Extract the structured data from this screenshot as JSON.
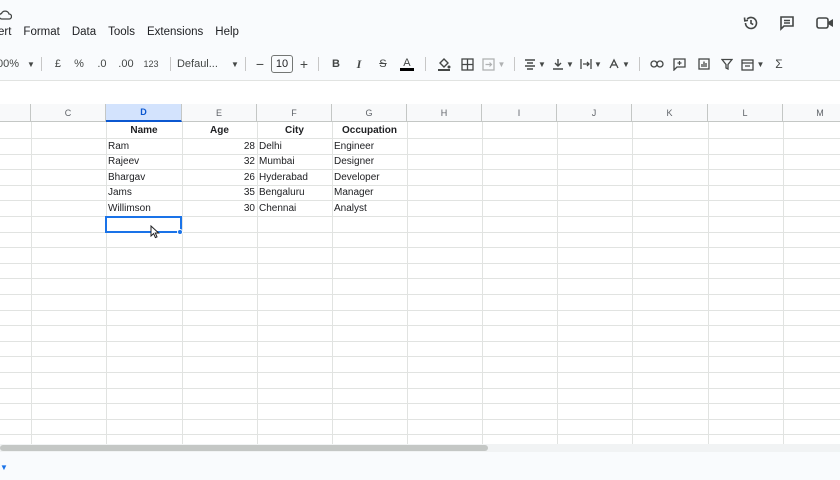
{
  "menu": [
    "ert",
    "Format",
    "Data",
    "Tools",
    "Extensions",
    "Help"
  ],
  "toolbar": {
    "zoom": "00%",
    "currency": "£",
    "percent": "%",
    "dec_decrease": ".0",
    "dec_increase": ".00",
    "number_format": "123",
    "font": "Defaul...",
    "font_size": "10",
    "minus": "−",
    "plus": "+",
    "bold": "B",
    "italic": "I",
    "strike": "S",
    "text_color": "A",
    "sum": "Σ"
  },
  "colors": {
    "accent": "#1a73e8",
    "selected_header_bg": "#d3e3fd",
    "grid_line": "#e1e3e1"
  },
  "columns": [
    "C",
    "D",
    "E",
    "F",
    "G",
    "H",
    "I",
    "J",
    "K",
    "L",
    "M"
  ],
  "selected_column": "D",
  "table": {
    "headers": [
      "Name",
      "Age",
      "City",
      "Occupation"
    ],
    "rows": [
      [
        "Ram",
        "28",
        "Delhi",
        "Engineer"
      ],
      [
        "Rajeev",
        "32",
        "Mumbai",
        "Designer"
      ],
      [
        "Bhargav",
        "26",
        "Hyderabad",
        "Developer"
      ],
      [
        "Jams",
        "35",
        "Bengaluru",
        "Manager"
      ],
      [
        "Willimson",
        "30",
        "Chennai",
        "Analyst"
      ]
    ]
  }
}
